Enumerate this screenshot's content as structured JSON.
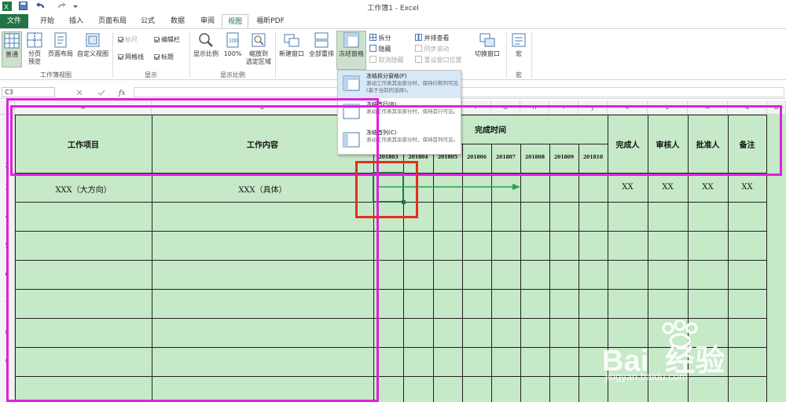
{
  "window": {
    "title": "工作簿1 - Excel"
  },
  "tabs": [
    {
      "label": "文件"
    },
    {
      "label": "开始"
    },
    {
      "label": "插入"
    },
    {
      "label": "页面布局"
    },
    {
      "label": "公式"
    },
    {
      "label": "数据"
    },
    {
      "label": "审阅"
    },
    {
      "label": "视图"
    },
    {
      "label": "福昕PDF"
    }
  ],
  "ribbon": {
    "workbook_views": {
      "group_label": "工作簿视图",
      "normal": "普通",
      "page_break": "分页\n预览",
      "page_layout": "页面布局",
      "custom_views": "自定义视图"
    },
    "show": {
      "group_label": "显示",
      "ruler": "标尺",
      "formula_bar": "编辑栏",
      "gridlines": "网格线",
      "headings": "标题"
    },
    "zoom": {
      "group_label": "显示比例",
      "zoom": "显示比例",
      "hundred": "100%",
      "zoom_to_selection": "缩放到\n选定区域"
    },
    "window": {
      "new_window": "新建窗口",
      "arrange_all": "全部重排",
      "freeze_panes": "冻结窗格",
      "split": "拆分",
      "hide": "隐藏",
      "unhide": "取消隐藏",
      "view_side_by_side": "并排查看",
      "sync_scroll": "同步滚动",
      "reset_position": "重设窗口位置",
      "switch_windows": "切换窗口"
    },
    "macros": {
      "label": "宏",
      "group_label": "宏"
    }
  },
  "formula_bar": {
    "name_box": "C3"
  },
  "freeze_menu": [
    {
      "title": "冻结拆分窗格(F)",
      "desc": "滚动工作表其余部分时，保持行和列可见(基于当前的选择)。"
    },
    {
      "title": "冻结首行(R)",
      "desc": "滚动工作表其余部分时，保持首行可见。"
    },
    {
      "title": "冻结首列(C)",
      "desc": "滚动工作表其余部分时，保持首列可见。"
    }
  ],
  "sheet": {
    "columns": [
      "A",
      "B",
      "C",
      "D",
      "E",
      "F",
      "G",
      "H",
      "I",
      "J",
      "K",
      "L",
      "M",
      "N",
      "O"
    ],
    "rows": [
      "1",
      "2",
      "3",
      "4",
      "5",
      "6",
      "7",
      "8",
      "9"
    ],
    "headers": {
      "work_item": "工作项目",
      "work_content": "工作内容",
      "completion_time": "完成时间",
      "completed_by": "完成人",
      "reviewer": "审核人",
      "approver": "批准人",
      "remarks": "备注"
    },
    "dates": [
      "201803",
      "201804",
      "201805",
      "201806",
      "201807",
      "201808",
      "201809",
      "201810"
    ],
    "row3": {
      "work_item": "XXX（大方向）",
      "work_content": "XXX（具体）",
      "completed_by": "XX",
      "reviewer": "XX",
      "approver": "XX",
      "remarks": "XX"
    }
  },
  "watermark": {
    "brand": "Bai  经验",
    "url": "jingyan.baidu.com"
  },
  "colors": {
    "excel_green": "#217346",
    "sheet_bg": "#c6e9c8",
    "highlight_magenta": "#e020e0",
    "highlight_red": "#e03020",
    "arrow_green": "#2e9e4a"
  }
}
